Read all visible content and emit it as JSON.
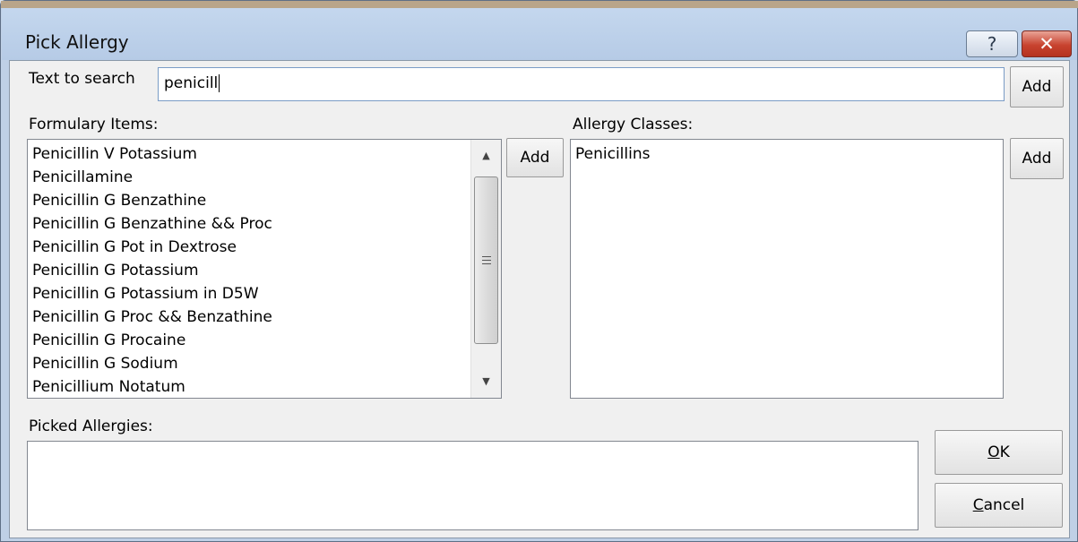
{
  "window": {
    "title": "Pick Allergy",
    "help_glyph": "?",
    "close_glyph": "✕"
  },
  "search": {
    "label": "Text to search",
    "value": "penicill",
    "add_label": "Add"
  },
  "formulary": {
    "label": "Formulary Items:",
    "add_label": "Add",
    "items": [
      "Penicillin V Potassium",
      "Penicillamine",
      "Penicillin G Benzathine",
      "Penicillin G Benzathine && Proc",
      "Penicillin G Pot in Dextrose",
      "Penicillin G Potassium",
      "Penicillin G Potassium in D5W",
      "Penicillin G Proc && Benzathine",
      "Penicillin G Procaine",
      "Penicillin G Sodium",
      "Penicillium Notatum"
    ]
  },
  "allergy_classes": {
    "label": "Allergy Classes:",
    "add_label": "Add",
    "items": [
      "Penicillins"
    ]
  },
  "picked": {
    "label": "Picked Allergies:",
    "items": []
  },
  "buttons": {
    "ok_mnemonic": "O",
    "ok_rest": "K",
    "cancel_mnemonic": "C",
    "cancel_rest": "ancel"
  }
}
